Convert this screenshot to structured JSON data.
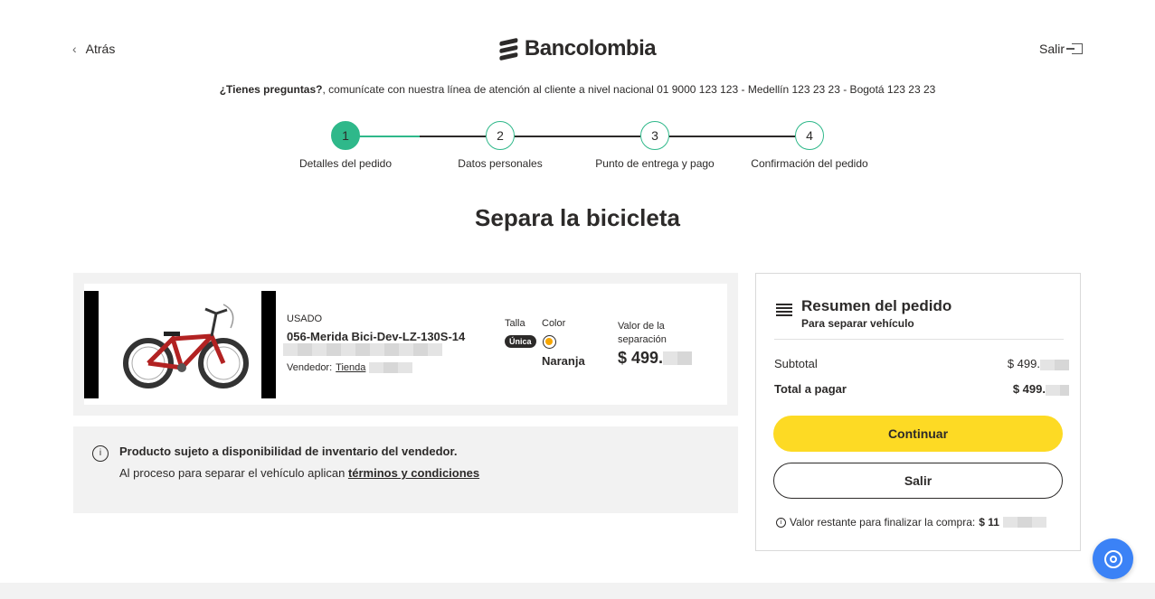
{
  "header": {
    "back_label": "Atrás",
    "brand_name": "Bancolombia",
    "exit_label": "Salir"
  },
  "help": {
    "bold": "¿Tienes preguntas?",
    "text": ", comunícate con nuestra línea de atención al cliente a nivel nacional 01 9000 123 123 - Medellín 123 23 23 - Bogotá 123 23 23"
  },
  "stepper": {
    "steps": [
      {
        "number": "1",
        "label": "Detalles del pedido",
        "state": "active"
      },
      {
        "number": "2",
        "label": "Datos personales",
        "state": "pending"
      },
      {
        "number": "3",
        "label": "Punto de entrega y pago",
        "state": "pending"
      },
      {
        "number": "4",
        "label": "Confirmación del pedido",
        "state": "pending"
      }
    ]
  },
  "page": {
    "title": "Separa la bicicleta"
  },
  "product": {
    "condition": "USADO",
    "name": "056-Merida Bici-Dev-LZ-130S-14 2.4-",
    "seller_label": "Vendedor:",
    "seller_name": "Tienda",
    "size_label": "Talla",
    "size_value": "Única",
    "color_label": "Color",
    "color_value": "Naranja",
    "color_hex": "#f7a600",
    "separation_label": "Valor de la separación",
    "separation_value": "$ 499."
  },
  "notice": {
    "title": "Producto sujeto a disponibilidad de inventario del vendedor.",
    "text": "Al proceso para separar el vehículo aplican ",
    "link": "términos y condiciones"
  },
  "summary": {
    "title": "Resumen del pedido",
    "subtitle": "Para separar vehículo",
    "subtotal_label": "Subtotal",
    "subtotal_value": "$ 499.",
    "total_label": "Total a pagar",
    "total_value": "$ 499.",
    "continue_label": "Continuar",
    "exit_label": "Salir",
    "remaining_label": "Valor restante para finalizar la compra:",
    "remaining_value": "$ 11"
  },
  "colors": {
    "accent_green": "#2fb88a",
    "primary_yellow": "#fdda24",
    "fab_blue": "#3b82f6",
    "text_dark": "#2c2a29"
  }
}
